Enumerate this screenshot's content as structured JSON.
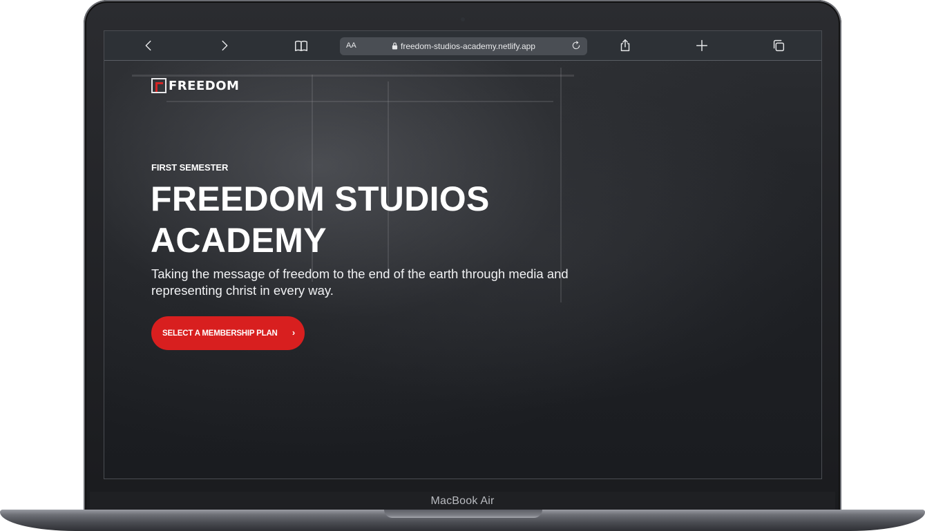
{
  "device": {
    "model_label": "MacBook Air"
  },
  "browser": {
    "back_icon": "chevron-left-icon",
    "forward_icon": "chevron-right-icon",
    "bookmarks_icon": "book-icon",
    "text_size_label": "AA",
    "url": "freedom-studios-academy.netlify.app",
    "secure": true,
    "reload_icon": "reload-icon",
    "share_icon": "share-icon",
    "new_tab_icon": "plus-icon",
    "tabs_icon": "tabs-icon"
  },
  "page": {
    "logo_text": "FREEDOM",
    "eyebrow": "FIRST SEMESTER",
    "headline": "FREEDOM STUDIOS ACADEMY",
    "subtext": "Taking the message of freedom to the end of the earth through media and representing christ in every way.",
    "cta_label": "SELECT A MEMBERSHIP PLAN",
    "cta_chevron": "›"
  },
  "colors": {
    "accent": "#d81f1f",
    "hero_bg": "#1c1e22",
    "toolbar_bg": "#2d3136"
  }
}
